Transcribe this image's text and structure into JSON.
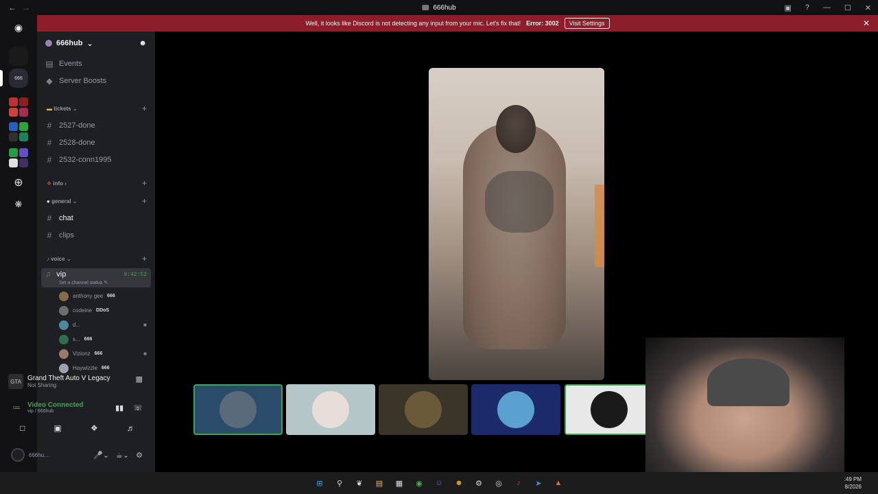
{
  "window": {
    "title": "666hub",
    "back_icon": "arrow-left-icon",
    "forward_icon": "arrow-right-icon"
  },
  "notice": {
    "message": "Well, it looks like Discord is not detecting any input from your mic. Let's fix that!",
    "error_label": "Error: 3002",
    "button": "Visit Settings",
    "bg_color": "#8b1e28"
  },
  "server": {
    "name": "666hub",
    "items": [
      {
        "label": "Events",
        "icon": "calendar-icon"
      },
      {
        "label": "Server Boosts",
        "icon": "boost-icon"
      }
    ],
    "categories": {
      "tickets": {
        "label": "tickets",
        "channels": [
          "2527-done",
          "2528-done",
          "2532-conn1995"
        ]
      },
      "info": {
        "label": "info"
      },
      "general": {
        "label": "general",
        "channels": [
          "chat",
          "clips"
        ]
      },
      "voice": {
        "label": "voice"
      }
    },
    "voice_channel": {
      "name": "vip",
      "timer": "9:42:52",
      "status_placeholder": "Set a channel status",
      "members": [
        {
          "name": "anthony gee",
          "tag": "666",
          "camera": false,
          "avatar_color": "#8a6a4a"
        },
        {
          "name": "codeine",
          "tag": "DDoS",
          "camera": false,
          "avatar_color": "#6d6d6d"
        },
        {
          "name": "d...",
          "tag": "",
          "camera": true,
          "avatar_color": "#4f86a0"
        },
        {
          "name": "s...",
          "tag": "666",
          "camera": false,
          "avatar_color": "#2f6f4f"
        },
        {
          "name": "Vizionz",
          "tag": "666",
          "camera": true,
          "avatar_color": "#9a7a6a"
        },
        {
          "name": "Haywizzle",
          "tag": "666",
          "camera": false,
          "avatar_color": "#a0a0b0"
        }
      ]
    }
  },
  "activity": {
    "game": "Grand Theft Auto V Legacy",
    "status": "Not Sharing",
    "icon_label": "GTA"
  },
  "voice_status": {
    "connected": "Video Connected",
    "location": "vip / 666hub",
    "accent": "#43a25a"
  },
  "user": {
    "name": "666hu...",
    "controls": [
      "mic-icon",
      "headphones-icon",
      "gear-icon"
    ]
  },
  "stage": {
    "tiles": [
      {
        "label": "camera-off",
        "bg": "#2b4b6b",
        "circle": "#5a6a7a",
        "selected": true
      },
      {
        "label": "avatar-woman",
        "bg": "#b4c6c8",
        "circle": "#e8ddd8",
        "selected": false
      },
      {
        "label": "avatar-man",
        "bg": "#3a3528",
        "circle": "#6a5a3a",
        "selected": false
      },
      {
        "label": "webcam-gamer",
        "bg": "#1a2a6a",
        "circle": "#5aa0d0",
        "selected": false
      },
      {
        "label": "avatar-mustache",
        "bg": "#e8e8e8",
        "circle": "#1a1a1a",
        "selected": true
      },
      {
        "label": "avatar-girl",
        "bg": "#4a3a3a",
        "circle": "#7a5a5a",
        "selected": false
      }
    ]
  },
  "taskbar": {
    "icons": [
      "windows-icon",
      "search-icon",
      "copilot-icon",
      "folder-icon",
      "store-icon",
      "chrome-icon",
      "discord-icon",
      "emoji-icon",
      "steam-icon",
      "obs-icon",
      "tiktok-icon",
      "telegram-icon",
      "app-icon"
    ],
    "time": ":49 PM",
    "date": "8/2026"
  }
}
